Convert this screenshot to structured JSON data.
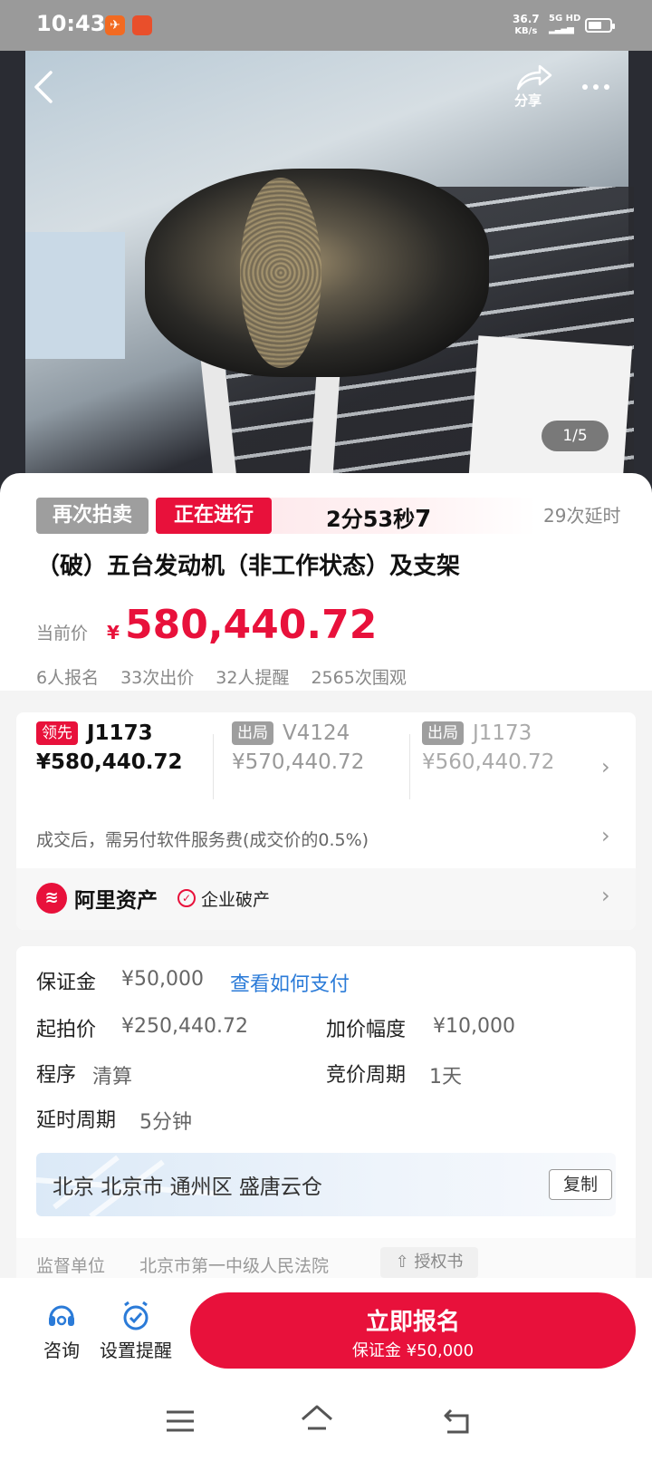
{
  "status_bar": {
    "time": "10:43",
    "net_speed": "36.7",
    "net_unit": "KB/s",
    "network": "5G HD"
  },
  "hero": {
    "share_label": "分享",
    "image_counter": "1/5"
  },
  "auction": {
    "tag_again": "再次拍卖",
    "tag_status": "正在进行",
    "countdown_main": "2分53秒",
    "countdown_sub": "7",
    "delay_count": "29次延时",
    "title": "（破）五台发动机（非工作状态）及支架",
    "current_price_label": "当前价",
    "currency": "¥",
    "current_price": "580,440.72",
    "stats": [
      "6人报名",
      "33次出价",
      "32人提醒",
      "2565次围观"
    ]
  },
  "bids": [
    {
      "tag": "领先",
      "bidder": "J1173",
      "amount": "¥580,440.72"
    },
    {
      "tag": "出局",
      "bidder": "V4124",
      "amount": "¥570,440.72"
    },
    {
      "tag": "出局",
      "bidder": "J1173",
      "amount": "¥560,440.72"
    }
  ],
  "fee_notice": "成交后，需另付软件服务费(成交价的0.5%)",
  "seller": {
    "name": "阿里资产",
    "type": "企业破产"
  },
  "details": {
    "deposit_label": "保证金",
    "deposit_value": "¥50,000",
    "deposit_link": "查看如何支付",
    "start_price_label": "起拍价",
    "start_price_value": "¥250,440.72",
    "increment_label": "加价幅度",
    "increment_value": "¥10,000",
    "procedure_label": "程序",
    "procedure_value": "清算",
    "bid_period_label": "竞价周期",
    "bid_period_value": "1天",
    "delay_period_label": "延时周期",
    "delay_period_value": "5分钟",
    "address": "北京 北京市 通州区 盛唐云仓",
    "copy_label": "复制",
    "supervisor_label": "监督单位",
    "supervisor_value": "北京市第一中级人民法院",
    "authorization_label": "授权书"
  },
  "action_bar": {
    "consult_label": "咨询",
    "reminder_label": "设置提醒",
    "signup_label": "立即报名",
    "signup_sub": "保证金 ¥50,000"
  },
  "colors": {
    "accent": "#e8113b",
    "link": "#2b7bd8",
    "muted": "#888888"
  },
  "icons": [
    "back-icon",
    "share-icon",
    "more-icon",
    "chevron-right-icon",
    "check-circle-icon",
    "headset-icon",
    "alarm-clock-icon",
    "menu-icon",
    "home-icon",
    "return-icon",
    "upload-icon"
  ]
}
